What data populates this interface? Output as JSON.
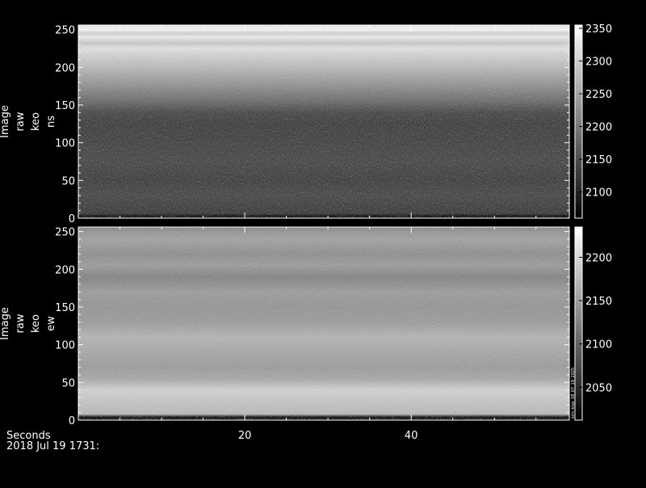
{
  "colors": {
    "background": "#000000",
    "foreground": "#ffffff"
  },
  "footer": {
    "xlabel": "Seconds",
    "timestamp": "2018 Jul 19 1731:"
  },
  "chart_data": [
    {
      "type": "heatmap",
      "ylabel_lines": [
        "Image",
        "raw",
        "keo",
        "ns"
      ],
      "x_range": [
        0,
        59
      ],
      "x_ticks": [
        20,
        40
      ],
      "y_range": [
        0,
        256
      ],
      "y_ticks": [
        0,
        50,
        100,
        150,
        200,
        250
      ],
      "colorbar": {
        "range": [
          2060,
          2355
        ],
        "ticks": [
          2100,
          2150,
          2200,
          2250,
          2300,
          2350
        ],
        "label": ""
      },
      "row_profile": {
        "y": [
          0,
          3,
          6,
          15,
          30,
          50,
          75,
          100,
          125,
          140,
          155,
          175,
          200,
          215,
          225,
          232,
          240,
          245,
          250,
          256
        ],
        "value": [
          2080,
          2085,
          2135,
          2140,
          2150,
          2140,
          2150,
          2145,
          2140,
          2150,
          2190,
          2230,
          2275,
          2300,
          2320,
          2290,
          2330,
          2300,
          2340,
          2320
        ]
      }
    },
    {
      "type": "heatmap",
      "ylabel_lines": [
        "Image",
        "raw",
        "keo",
        "ew"
      ],
      "x_range": [
        0,
        59
      ],
      "x_ticks": [
        20,
        40
      ],
      "y_range": [
        0,
        256
      ],
      "y_ticks": [
        0,
        50,
        100,
        150,
        200,
        250
      ],
      "colorbar": {
        "range": [
          2012,
          2235
        ],
        "ticks": [
          2050,
          2100,
          2150,
          2200
        ],
        "label": "sim_kisp_18_07_19_2025"
      },
      "row_profile": {
        "y": [
          0,
          4,
          8,
          20,
          40,
          55,
          70,
          90,
          110,
          130,
          150,
          170,
          190,
          205,
          220,
          240,
          250,
          256
        ],
        "value": [
          2030,
          2030,
          2175,
          2180,
          2195,
          2160,
          2150,
          2160,
          2170,
          2150,
          2145,
          2150,
          2130,
          2150,
          2140,
          2155,
          2145,
          2130
        ]
      }
    }
  ]
}
